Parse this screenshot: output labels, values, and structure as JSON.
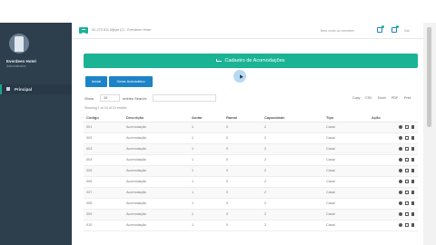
{
  "sidebar": {
    "profile_name": "Everdeen Hotel",
    "profile_sub": "Administrador",
    "nav_items": [
      {
        "label": "Principal",
        "icon": "home-icon"
      }
    ]
  },
  "topbar": {
    "breadcrumb": "02-270 811 Mjbjm (2) - Everdeen Hotel",
    "welcome": "Bem-vindo ao everdeen",
    "sair": "Sair",
    "icons": [
      "envelope-icon",
      "bell-icon",
      "signout-icon"
    ]
  },
  "banner": {
    "title": "Cadastro de Acomodações",
    "icon": "bed-icon"
  },
  "buttons": {
    "novo": "Inicial",
    "gerar": "Gerar Automático"
  },
  "table_controls": {
    "show_label": "Show",
    "show_value": "10",
    "search_label": "entries Search:",
    "search_placeholder": "",
    "showing_text": "Showing 1 to 10 of 10 entries",
    "export_buttons": [
      "Copy",
      "CSV",
      "Excel",
      "PDF",
      "Print"
    ]
  },
  "table": {
    "headers": [
      "Código",
      "Descrição",
      "Andar",
      "Ramal",
      "Capacidade",
      "Tipo",
      "Ação"
    ],
    "rows": [
      [
        "001",
        "Acomodação",
        "1",
        "0",
        "2",
        "Casal"
      ],
      [
        "002",
        "Acomodação",
        "1",
        "0",
        "2",
        "Casal"
      ],
      [
        "003",
        "Acomodação",
        "1",
        "0",
        "2",
        "Casal"
      ],
      [
        "004",
        "Acomodação",
        "1",
        "0",
        "2",
        "Casal"
      ],
      [
        "005",
        "Acomodação",
        "1",
        "0",
        "2",
        "Casal"
      ],
      [
        "006",
        "Acomodação",
        "1",
        "0",
        "2",
        "Casal"
      ],
      [
        "007",
        "Acomodação",
        "1",
        "0",
        "2",
        "Casal"
      ],
      [
        "008",
        "Acomodação",
        "1",
        "0",
        "2",
        "Casal"
      ],
      [
        "009",
        "Acomodação",
        "1",
        "0",
        "2",
        "Casal"
      ],
      [
        "010",
        "Acomodação",
        "1",
        "0",
        "2",
        "Casal"
      ]
    ]
  },
  "colors": {
    "sidebar": "#2d3e4c",
    "accent_green": "#1ab394",
    "button_blue": "#1c84c6"
  }
}
